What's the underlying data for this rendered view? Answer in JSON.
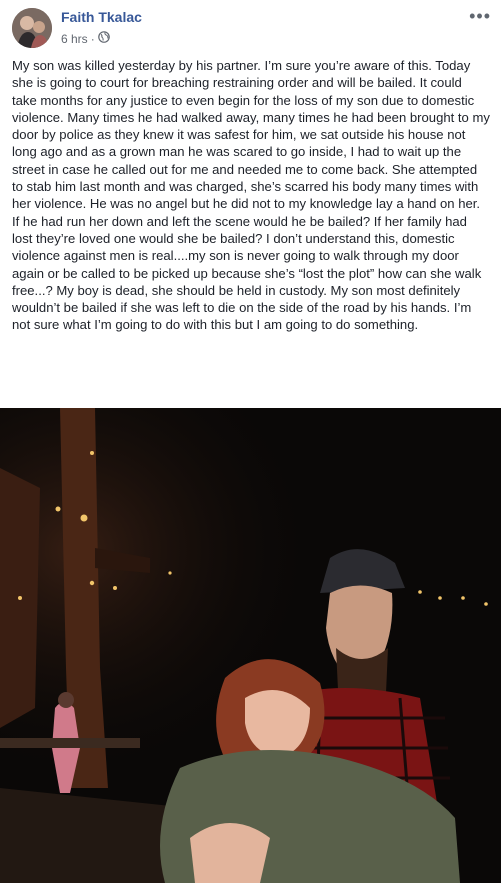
{
  "post": {
    "author": "Faith Tkalac",
    "time": "6 hrs",
    "audience_icon": "globe-icon",
    "menu_icon": "more-options-icon",
    "paragraphs": [
      "My son was killed yesterday by his partner. I’m sure you’re aware of this. Today she is going to court for breaching restraining order and will be bailed. It could take months for any justice to even begin for the loss of my son due to domestic violence. Many times he had walked away, many times he had been brought to my door by police as they knew it was safest for him, we sat outside his house not long ago and as a grown man he was scared to go inside, I had to wait up the street in case he called out for me and needed me to come back. She attempted to stab him last month and was charged, she’s scarred his body many times with her violence. He was no angel but he did not to my knowledge lay a hand on her.",
      "If he had run her down and left the scene would he be bailed? If her family had lost they’re loved one would she be bailed? I don’t understand this, domestic violence against men is real....my son is never going to walk through my door again or be called to be picked up because she’s “lost the plot” how can she walk free...? My boy is dead, she should be held in custody. My son most definitely wouldn’t be bailed if she was left to die on the side of the road by his hands. I’m not sure what I’m going to do with this but I am going to do something."
    ]
  },
  "colors": {
    "author_link": "#385898",
    "meta_text": "#616770",
    "body_text": "#1d2129",
    "photo_background": "#0a0807"
  }
}
